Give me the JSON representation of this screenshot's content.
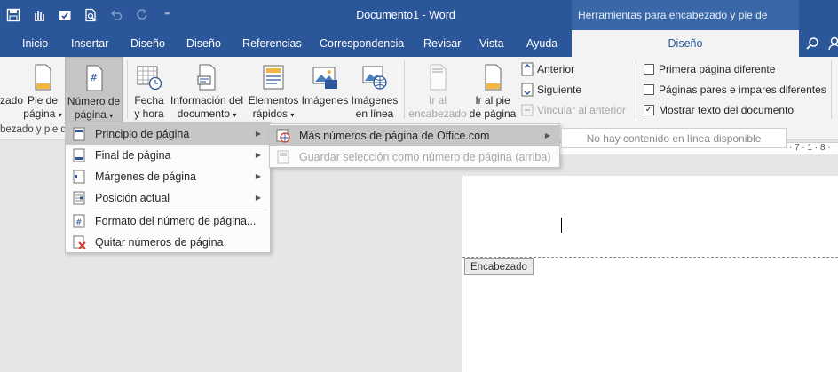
{
  "window": {
    "title": "Documento1 - Word",
    "context_title": "Herramientas para encabezado y pie de página"
  },
  "qat": {
    "icons": [
      "save-icon",
      "touch-mode-icon",
      "autosave-icon",
      "print-preview-icon",
      "undo-icon",
      "redo-icon",
      "customize-icon"
    ],
    "customize_glyph": "⁼"
  },
  "tabs": [
    {
      "label": "Inicio"
    },
    {
      "label": "Insertar"
    },
    {
      "label": "Diseño"
    },
    {
      "label": "Diseño"
    },
    {
      "label": "Referencias"
    },
    {
      "label": "Correspondencia"
    },
    {
      "label": "Revisar"
    },
    {
      "label": "Vista"
    },
    {
      "label": "Ayuda"
    }
  ],
  "context_tab": {
    "label": "Diseño"
  },
  "ribbon": {
    "encabezado_partial": "zado",
    "pie": {
      "line1": "Pie de",
      "line2": "página"
    },
    "numero": {
      "line1": "Número de",
      "line2": "página"
    },
    "fecha": {
      "line1": "Fecha",
      "line2": "y hora"
    },
    "info": {
      "line1": "Información del",
      "line2": "documento"
    },
    "elementos": {
      "line1": "Elementos",
      "line2": "rápidos"
    },
    "imagenes": {
      "line1": "Imágenes"
    },
    "imagenes_linea": {
      "line1": "Imágenes",
      "line2": "en línea"
    },
    "ir_encabezado": {
      "line1": "Ir al",
      "line2": "encabezado"
    },
    "ir_pie": {
      "line1": "Ir al pie",
      "line2": "de página"
    },
    "anterior": "Anterior",
    "siguiente": "Siguiente",
    "vincular": "Vincular al anterior",
    "checks": {
      "primera": "Primera página diferente",
      "pares": "Páginas pares e impares diferentes",
      "mostrar": "Mostrar texto del documento"
    },
    "group_label": "bezado y pie d"
  },
  "menu_main": {
    "items": [
      {
        "label": "Principio de página",
        "submenu": true,
        "highlighted": true
      },
      {
        "label": "Final de página",
        "submenu": true
      },
      {
        "label": "Márgenes de página",
        "submenu": true
      },
      {
        "label": "Posición actual",
        "submenu": true
      },
      {
        "label": "Formato del número de página..."
      },
      {
        "label": "Quitar números de página"
      }
    ]
  },
  "menu_sub": {
    "items": [
      {
        "label": "Más números de página de Office.com",
        "submenu": true,
        "highlighted": true
      },
      {
        "label": "Guardar selección como número de página (arriba)",
        "disabled": true
      }
    ]
  },
  "tooltip": "No hay contenido en línea disponible",
  "document": {
    "header_tag": "Encabezado",
    "ruler_marks": "· 7 · 1 · 8 ·"
  },
  "colors": {
    "accent": "#2b579a",
    "ribbon_bg": "#f3f3f3",
    "menu_highlight": "#c6c6c6"
  }
}
